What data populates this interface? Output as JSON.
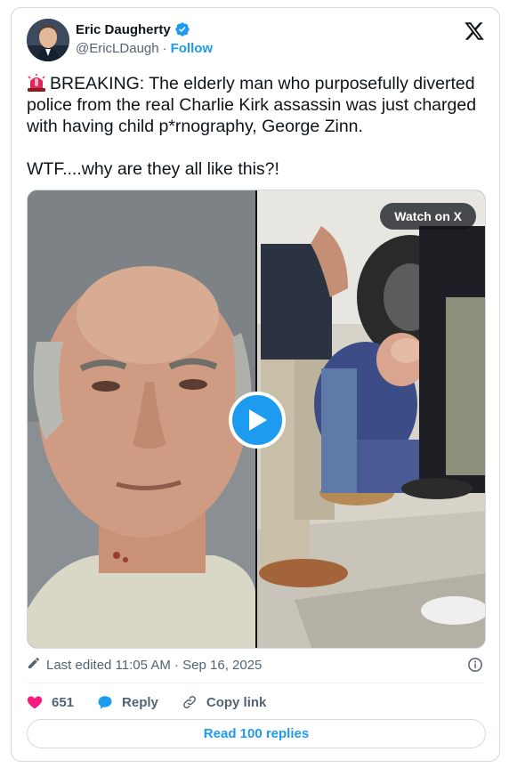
{
  "author": {
    "display_name": "Eric Daugherty",
    "handle": "@EricLDaugh",
    "separator": "·",
    "follow_label": "Follow",
    "verified": true
  },
  "tweet": {
    "line1": "BREAKING: The elderly man who purposefully diverted police from the real Charlie Kirk assassin was just charged with having child p*rnography, George Zinn.",
    "line2": "WTF....why are they all like this?!",
    "emoji": "siren-icon"
  },
  "media": {
    "watch_label": "Watch on X",
    "type": "video"
  },
  "meta": {
    "edited_label": "Last edited 11:05 AM · Sep 16, 2025"
  },
  "actions": {
    "like_count": "651",
    "reply_label": "Reply",
    "copy_label": "Copy link"
  },
  "footer": {
    "read_replies_label": "Read 100 replies"
  },
  "colors": {
    "accent": "#1d9bf0",
    "like": "#f91880",
    "text": "#0f1419",
    "secondary": "#536471",
    "border": "#cfd9de"
  }
}
